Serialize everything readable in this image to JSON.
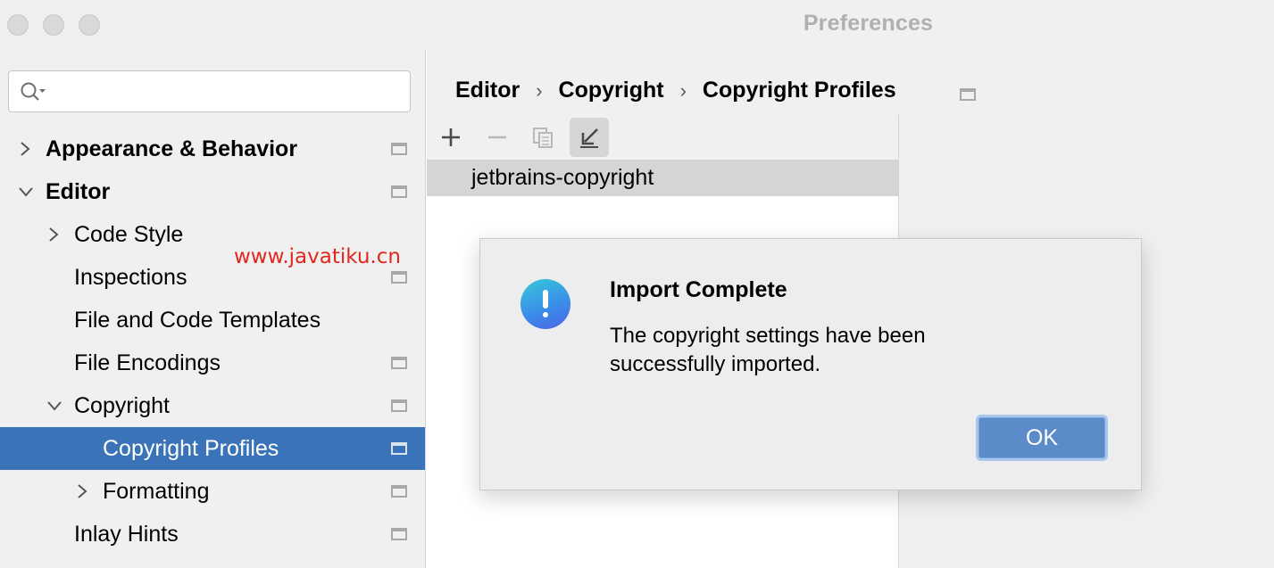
{
  "window": {
    "title": "Preferences"
  },
  "search": {
    "placeholder": ""
  },
  "watermark": "www.javatiku.cn",
  "sidebar": {
    "items": [
      {
        "label": "Appearance & Behavior"
      },
      {
        "label": "Editor"
      },
      {
        "label": "Code Style"
      },
      {
        "label": "Inspections"
      },
      {
        "label": "File and Code Templates"
      },
      {
        "label": "File Encodings"
      },
      {
        "label": "Copyright"
      },
      {
        "label": "Copyright Profiles"
      },
      {
        "label": "Formatting"
      },
      {
        "label": "Inlay Hints"
      }
    ],
    "selected": "Copyright Profiles"
  },
  "breadcrumb": {
    "items": [
      "Editor",
      "Copyright",
      "Copyright Profiles"
    ],
    "separator": "›"
  },
  "toolbar": {
    "buttons": [
      {
        "icon": "plus-icon"
      },
      {
        "icon": "minus-icon"
      },
      {
        "icon": "copy-icon"
      },
      {
        "icon": "import-icon"
      }
    ]
  },
  "profiles": {
    "items": [
      "jetbrains-copyright"
    ]
  },
  "dialog": {
    "title": "Import Complete",
    "message": "The copyright settings have been successfully imported.",
    "ok_label": "OK",
    "icon": "info-exclamation-icon"
  },
  "colors": {
    "selection": "#3b73b9",
    "ok_button": "#5b8bc8",
    "watermark": "#e0281e"
  }
}
